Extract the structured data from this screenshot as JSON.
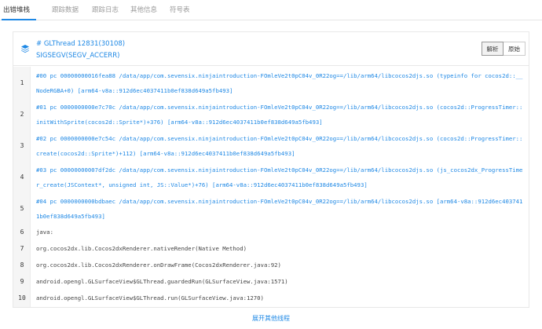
{
  "tabs": [
    {
      "label": "出错堆栈",
      "active": true
    },
    {
      "label": "跟踪数据",
      "active": false
    },
    {
      "label": "跟踪日志",
      "active": false
    },
    {
      "label": "其他信息",
      "active": false
    },
    {
      "label": "符号表",
      "active": false
    }
  ],
  "thread": {
    "title": "# GLThread 12831(30108)",
    "signal": "SIGSEGV(SEGV_ACCERR)",
    "icon": "layers-icon"
  },
  "buttons": {
    "parse": "解析",
    "raw": "原始"
  },
  "stack_lines": [
    {
      "num": "1",
      "text": "#00 pc 00000000016fea88 /data/app/com.sevensix.ninjaintroduction-FOmleVe2t0pC04v_0R22og==/lib/arm64/libcocos2djs.so (typeinfo for cocos2d::__NodeRGBA+0) [arm64-v8a::912d6ec4037411b0ef838d649a5fb493]",
      "kind": "app"
    },
    {
      "num": "2",
      "text": "#01 pc 0000000000e7c70c /data/app/com.sevensix.ninjaintroduction-FOmleVe2t0pC04v_0R22og==/lib/arm64/libcocos2djs.so (cocos2d::ProgressTimer::initWithSprite(cocos2d::Sprite*)+376) [arm64-v8a::912d6ec4037411b0ef838d649a5fb493]",
      "kind": "app"
    },
    {
      "num": "3",
      "text": "#02 pc 0000000000e7c54c /data/app/com.sevensix.ninjaintroduction-FOmleVe2t0pC04v_0R22og==/lib/arm64/libcocos2djs.so (cocos2d::ProgressTimer::create(cocos2d::Sprite*)+112) [arm64-v8a::912d6ec4037411b0ef838d649a5fb493]",
      "kind": "app"
    },
    {
      "num": "4",
      "text": "#03 pc 00000000007df2dc /data/app/com.sevensix.ninjaintroduction-FOmleVe2t0pC04v_0R22og==/lib/arm64/libcocos2djs.so (js_cocos2dx_ProgressTimer_create(JSContext*, unsigned int, JS::Value*)+76) [arm64-v8a::912d6ec4037411b0ef838d649a5fb493]",
      "kind": "app"
    },
    {
      "num": "5",
      "text": "#04 pc 0000000000bdbaec /data/app/com.sevensix.ninjaintroduction-FOmleVe2t0pC04v_0R22og==/lib/arm64/libcocos2djs.so [arm64-v8a::912d6ec4037411b0ef838d649a5fb493]",
      "kind": "app"
    },
    {
      "num": "6",
      "text": "java:",
      "kind": "sys"
    },
    {
      "num": "7",
      "text": "org.cocos2dx.lib.Cocos2dxRenderer.nativeRender(Native Method)",
      "kind": "sys"
    },
    {
      "num": "8",
      "text": "org.cocos2dx.lib.Cocos2dxRenderer.onDrawFrame(Cocos2dxRenderer.java:92)",
      "kind": "sys"
    },
    {
      "num": "9",
      "text": "android.opengl.GLSurfaceView$GLThread.guardedRun(GLSurfaceView.java:1571)",
      "kind": "sys"
    },
    {
      "num": "10",
      "text": "android.opengl.GLSurfaceView$GLThread.run(GLSurfaceView.java:1270)",
      "kind": "sys"
    }
  ],
  "expand_label": "展开其他线程",
  "colors": {
    "accent": "#1e88e5",
    "gutter": "#f5f5f5"
  }
}
